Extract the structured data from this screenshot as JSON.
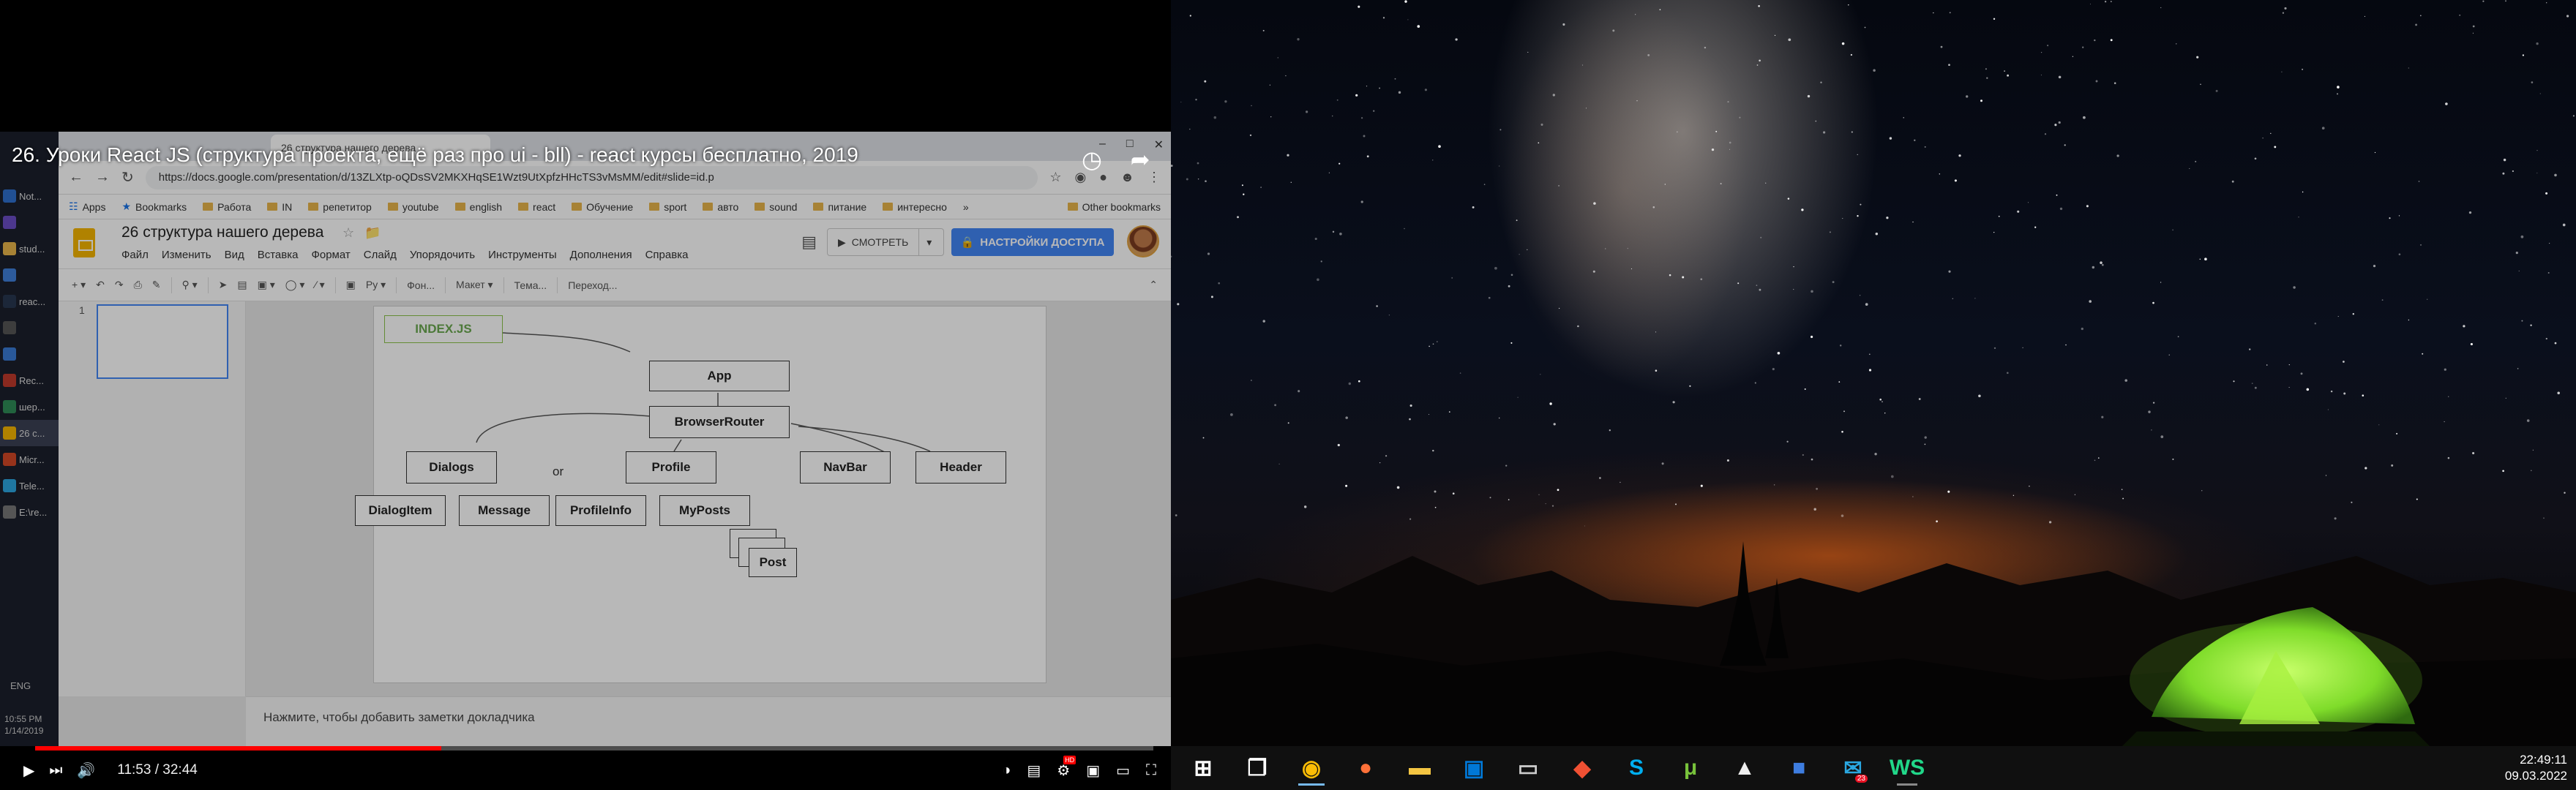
{
  "video": {
    "title": "26. Уроки React JS (структура проекта, ещё раз про ui - bll) - react курсы бесплатно, 2019",
    "time_current": "11:53",
    "time_total": "32:44",
    "time_separator": "/",
    "progress_fraction": 0.363
  },
  "recorded_taskbar": {
    "items": [
      {
        "label": "Not...",
        "color": "#2f6fce"
      },
      {
        "label": "",
        "color": "#6a4dc4"
      },
      {
        "label": "stud...",
        "color": "#e8b54a"
      },
      {
        "label": "",
        "color": "#3f7ed9"
      },
      {
        "label": "reac...",
        "color": "#27364f"
      },
      {
        "label": "",
        "color": "#555"
      },
      {
        "label": "",
        "color": "#3a7bd5"
      },
      {
        "label": "Rec...",
        "color": "#c0392b"
      },
      {
        "label": "шер...",
        "color": "#2e8b57"
      },
      {
        "label": "26 с...",
        "color": "#f4b400"
      },
      {
        "label": "Micr...",
        "color": "#d24726"
      },
      {
        "label": "Tele...",
        "color": "#2ca5e0"
      },
      {
        "label": "E:\\re...",
        "color": "#777"
      }
    ],
    "lang": "ENG",
    "time": "10:55 PM",
    "date": "1/14/2019"
  },
  "browser": {
    "tab_title": "26 структура нашего дерева",
    "url": "https://docs.google.com/presentation/d/13ZLXtp-oQDsSV2MKXHqSE1Wzt9UtXpfzHHcTS3vMsMM/edit#slide=id.p",
    "bookmarks": [
      {
        "label": "Apps",
        "kind": "apps"
      },
      {
        "label": "Bookmarks",
        "kind": "star"
      },
      {
        "label": "Работа",
        "kind": "folder"
      },
      {
        "label": "IN",
        "kind": "folder"
      },
      {
        "label": "репетитор",
        "kind": "folder"
      },
      {
        "label": "youtube",
        "kind": "folder"
      },
      {
        "label": "english",
        "kind": "folder"
      },
      {
        "label": "react",
        "kind": "folder"
      },
      {
        "label": "Обучение",
        "kind": "folder"
      },
      {
        "label": "sport",
        "kind": "folder"
      },
      {
        "label": "авто",
        "kind": "folder"
      },
      {
        "label": "sound",
        "kind": "folder"
      },
      {
        "label": "питание",
        "kind": "folder"
      },
      {
        "label": "интересно",
        "kind": "folder"
      }
    ],
    "bookmarks_more": "»",
    "other_bookmarks": "Other bookmarks"
  },
  "slides": {
    "doc_title": "26 структура нашего дерева",
    "menus": [
      "Файл",
      "Изменить",
      "Вид",
      "Вставка",
      "Формат",
      "Слайд",
      "Упорядочить",
      "Инструменты",
      "Дополнения",
      "Справка"
    ],
    "watch_label": "СМОТРЕТЬ",
    "share_label": "НАСТРОЙКИ ДОСТУПА",
    "toolbar": {
      "font": "Ру",
      "background": "Фон...",
      "layout": "Макет",
      "theme": "Тема...",
      "transition": "Переход..."
    },
    "thumb_number": "1",
    "notes_placeholder": "Нажмите, чтобы добавить заметки докладчика",
    "diagram": {
      "index_label": "INDEX.JS",
      "or_label": "or",
      "nodes": {
        "app": "App",
        "router": "BrowserRouter",
        "dialogs": "Dialogs",
        "profile": "Profile",
        "navbar": "NavBar",
        "header": "Header",
        "dialogitem": "DialogItem",
        "message": "Message",
        "profileinfo": "ProfileInfo",
        "myposts": "MyPosts",
        "post": "Post"
      }
    }
  },
  "desktop_taskbar": {
    "apps": [
      {
        "name": "start-icon"
      },
      {
        "name": "task-view-icon"
      },
      {
        "name": "chrome-icon",
        "state": "active"
      },
      {
        "name": "firefox-icon"
      },
      {
        "name": "file-explorer-icon"
      },
      {
        "name": "store-icon"
      },
      {
        "name": "terminal-icon"
      },
      {
        "name": "git-icon"
      },
      {
        "name": "skype-icon"
      },
      {
        "name": "utorrent-icon"
      },
      {
        "name": "fox-icon"
      },
      {
        "name": "floppy-icon"
      },
      {
        "name": "mail-icon",
        "badge": "23"
      },
      {
        "name": "webstorm-icon",
        "state": "open"
      }
    ],
    "time": "22:49:11",
    "date": "09.03.2022"
  },
  "colors": {
    "progress": "#ff0000",
    "share_button": "#4285f4",
    "slides_logo": "#f4b400",
    "index_box": "#6aa84f",
    "tent": "#7fdc2a"
  }
}
